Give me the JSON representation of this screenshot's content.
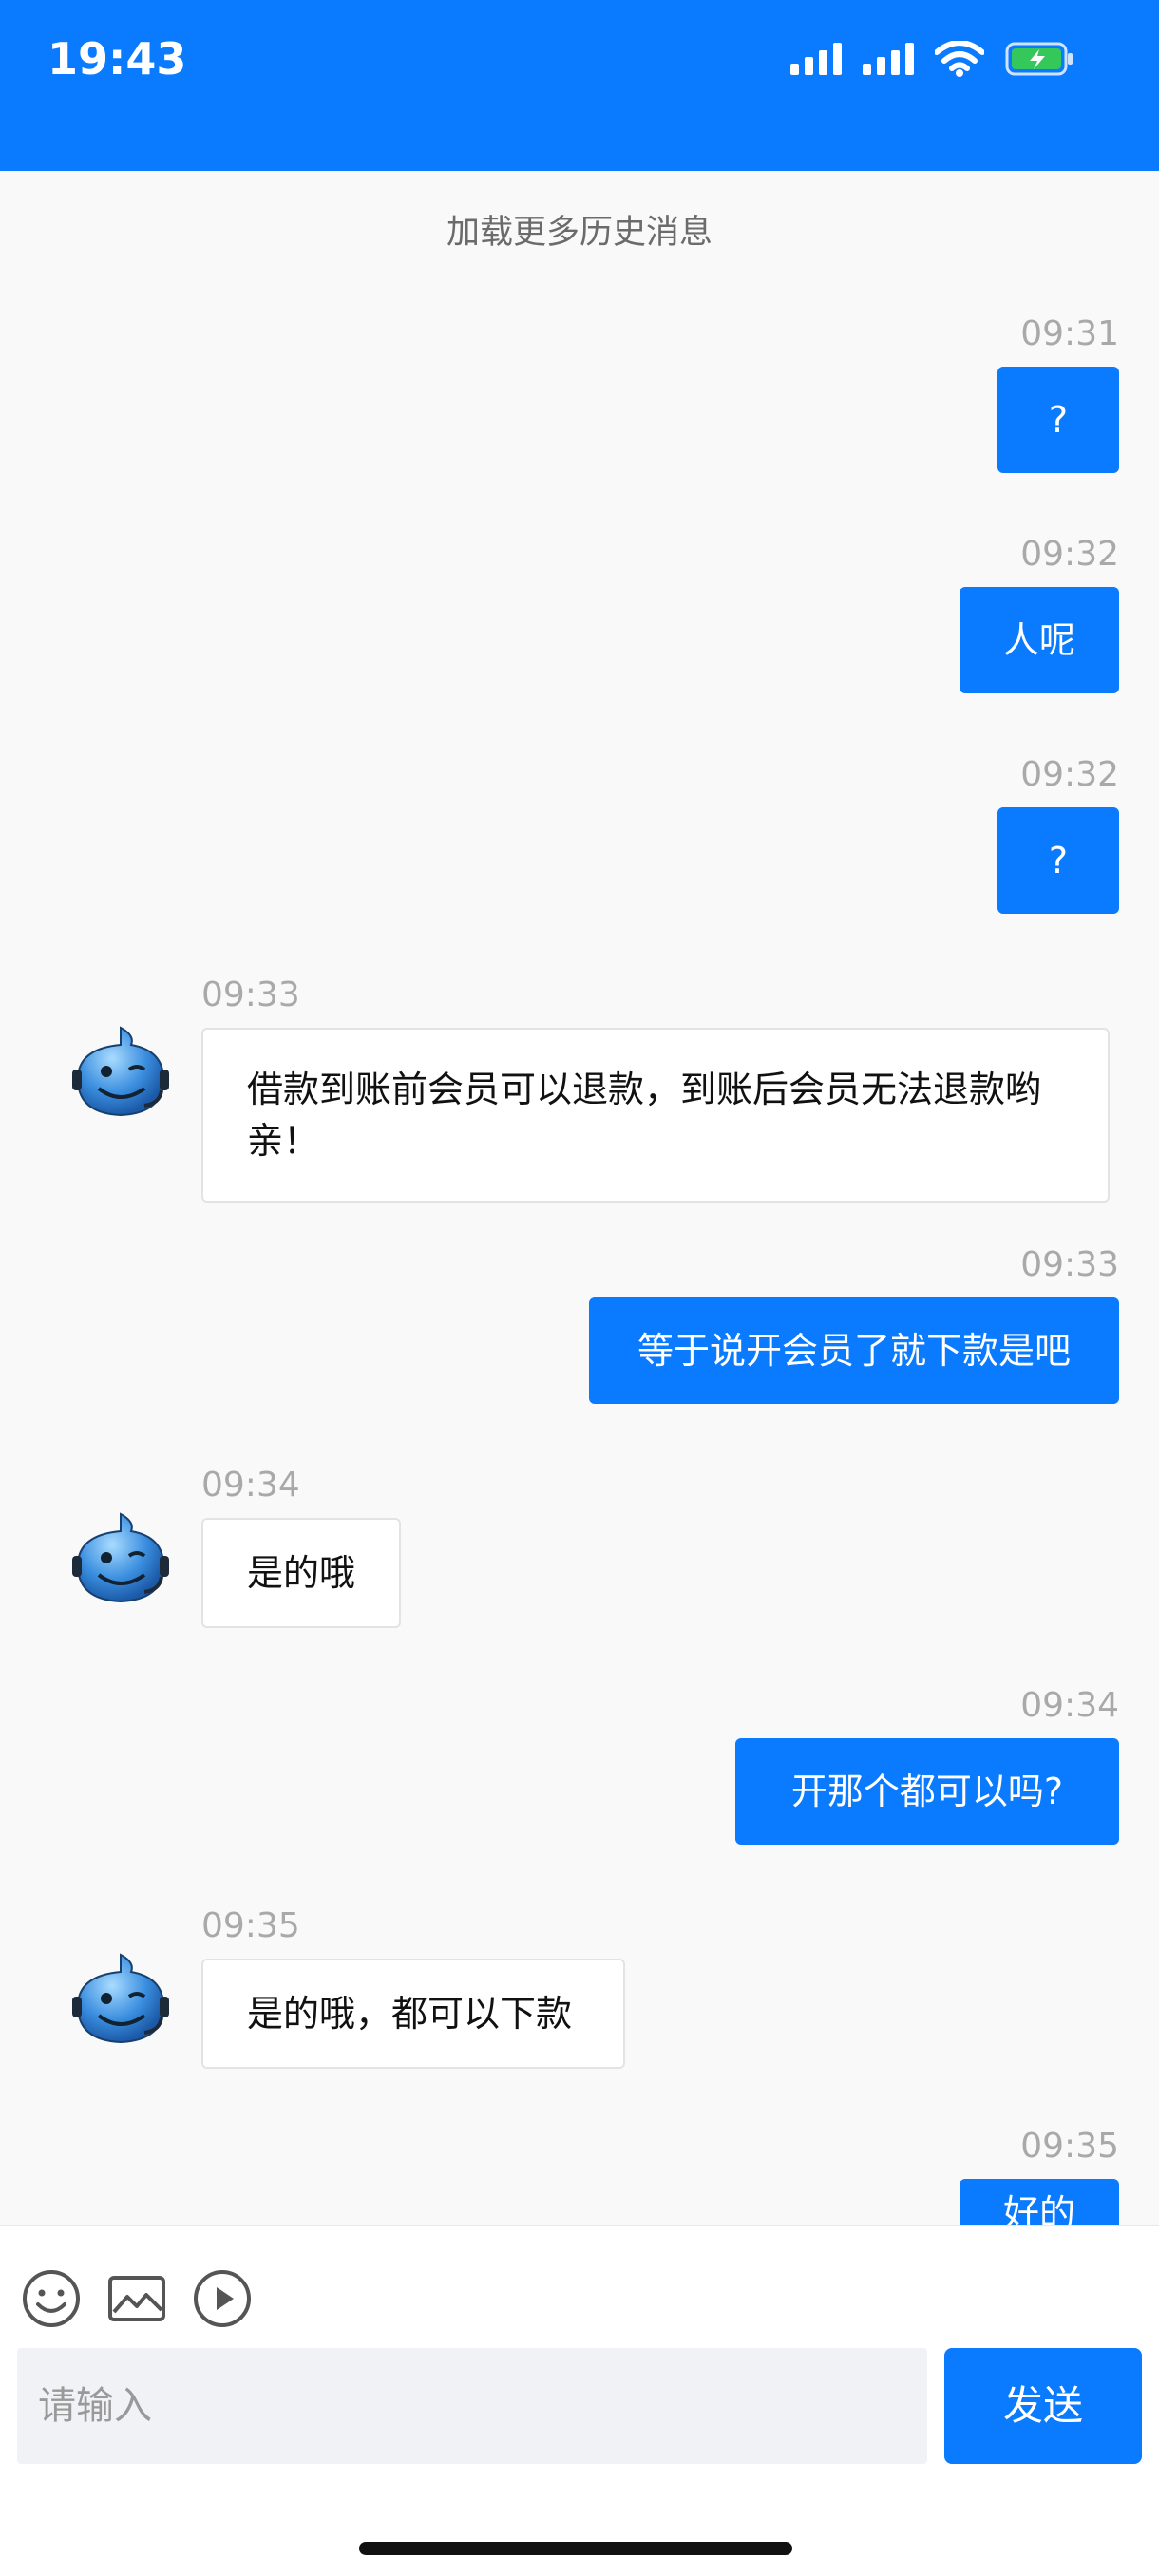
{
  "status_bar": {
    "time": "19:43",
    "bg_color": "#0a7aff",
    "icons": [
      "signal-icon",
      "signal-icon",
      "wifi-icon",
      "battery-charging-icon"
    ]
  },
  "chat": {
    "load_more": "加载更多历史消息",
    "messages": [
      {
        "side": "out",
        "time": "09:31",
        "text": "?"
      },
      {
        "side": "out",
        "time": "09:32",
        "text": "人呢"
      },
      {
        "side": "out",
        "time": "09:32",
        "text": "?"
      },
      {
        "side": "in",
        "time": "09:33",
        "text_line1": "借款到账前会员可以退款，到账后会员无法退款哟",
        "text_line2": "亲！"
      },
      {
        "side": "out",
        "time": "09:33",
        "text": "等于说开会员了就下款是吧"
      },
      {
        "side": "in",
        "time": "09:34",
        "text": "是的哦"
      },
      {
        "side": "out",
        "time": "09:34",
        "text": "开那个都可以吗?"
      },
      {
        "side": "in",
        "time": "09:35",
        "text": "是的哦，都可以下款"
      },
      {
        "side": "out",
        "time": "09:35",
        "text": "好的"
      }
    ]
  },
  "composer": {
    "placeholder": "请输入",
    "send_label": "发送",
    "tools": [
      "emoji-icon",
      "image-icon",
      "video-icon"
    ]
  },
  "colors": {
    "accent": "#0a7aff",
    "background": "#f9f9f9"
  }
}
